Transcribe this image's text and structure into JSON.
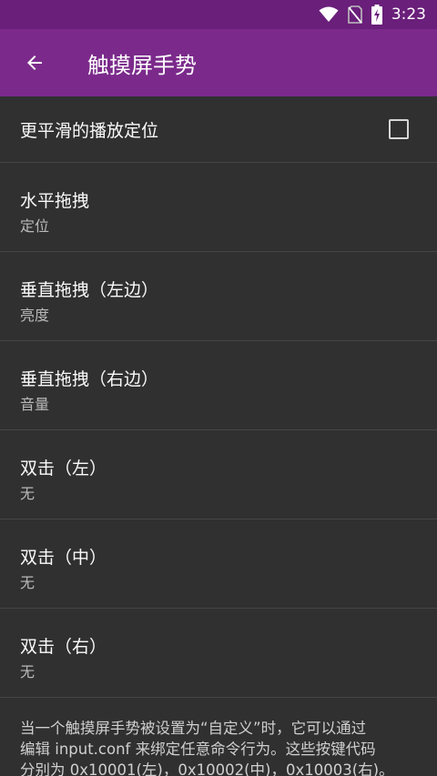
{
  "status_bar": {
    "time": "3:23"
  },
  "toolbar": {
    "title": "触摸屏手势"
  },
  "items": [
    {
      "title": "更平滑的播放定位",
      "type": "checkbox",
      "checked": false
    },
    {
      "title": "水平拖拽",
      "summary": "定位"
    },
    {
      "title": "垂直拖拽（左边）",
      "summary": "亮度"
    },
    {
      "title": "垂直拖拽（右边）",
      "summary": "音量"
    },
    {
      "title": "双击（左）",
      "summary": "无"
    },
    {
      "title": "双击（中）",
      "summary": "无"
    },
    {
      "title": "双击（右）",
      "summary": "无"
    }
  ],
  "info": {
    "line1": "当一个触摸屏手势被设置为“自定义”时，它可以通过",
    "line2": "编辑 input.conf 来绑定任意命令行为。这些按键代码",
    "line3": "分别为 0x10001(左)，0x10002(中)，0x10003(右)。"
  },
  "colors": {
    "status_bar": "#6a1f7a",
    "toolbar": "#7b2a8b",
    "background": "#303030"
  }
}
